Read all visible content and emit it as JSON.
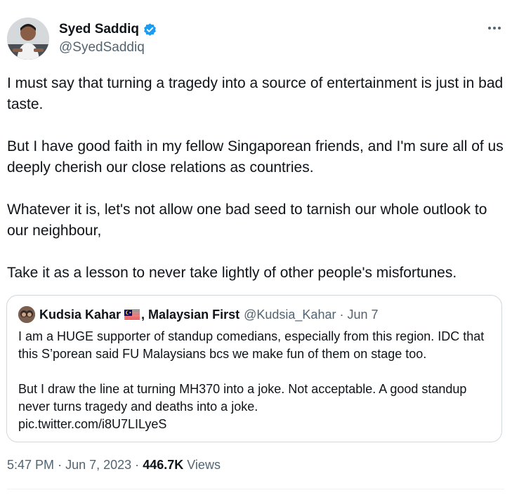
{
  "author": {
    "name": "Syed Saddiq",
    "handle": "@SyedSaddiq",
    "verified": true,
    "verified_color": "#1d9bf0"
  },
  "tweet": {
    "paragraphs": [
      "I must say that turning a tragedy into a source of entertainment is just in bad taste.",
      "But I have good faith in my fellow Singaporean friends, and I'm sure all of us deeply cherish our close relations as countries.",
      "Whatever it is, let's not allow one bad seed to tarnish our whole outlook to our neighbour,",
      "Take it as a lesson to never take lightly of other people's misfortunes."
    ]
  },
  "quote": {
    "name_part1": "Kudsia Kahar",
    "flag_icon": "malaysia-flag-icon",
    "name_part2": ", Malaysian First",
    "handle": "@Kudsia_Kahar",
    "separator": "·",
    "date": "Jun 7",
    "paragraphs": [
      "I am a HUGE supporter of standup comedians, especially from this region. IDC that this S’porean said FU Malaysians bcs we make fun of them on stage too.",
      "But I draw the line at turning MH370 into a joke. Not acceptable. A good standup never turns tragedy and deaths into a joke.\npic.twitter.com/i8U7LILyeS"
    ]
  },
  "meta": {
    "time": "5:47 PM",
    "separator": "·",
    "date": "Jun 7, 2023",
    "views_count": "446.7K",
    "views_label": "Views"
  },
  "icons": {
    "more": "more-options-icon",
    "verified": "verified-badge-icon"
  }
}
